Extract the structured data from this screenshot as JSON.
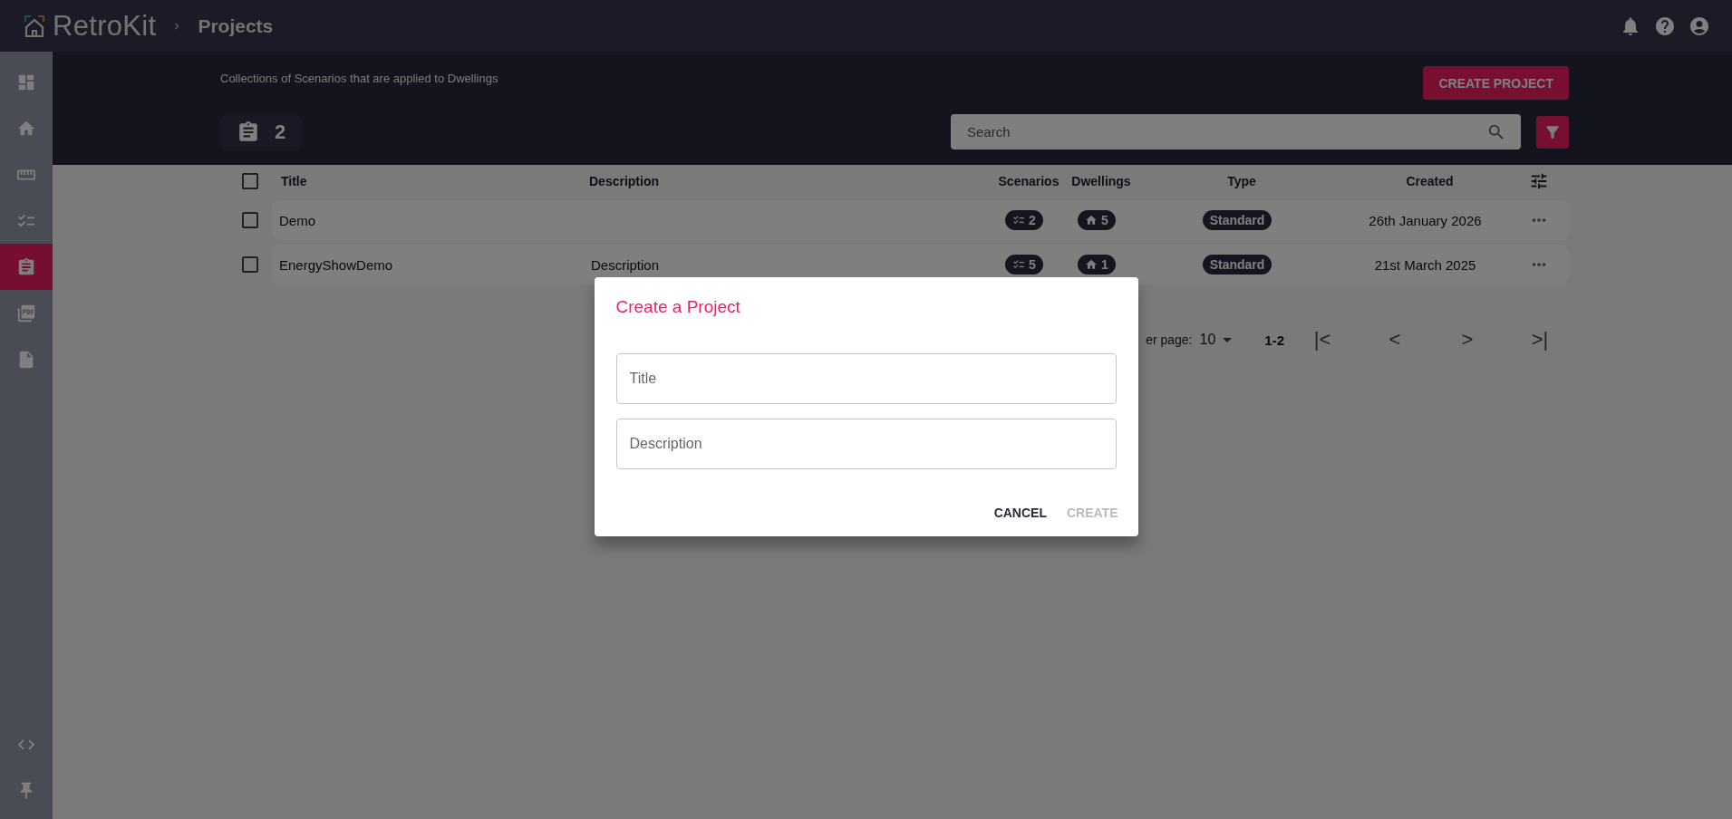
{
  "app": {
    "name": "RetroKit",
    "breadcrumb": "Projects"
  },
  "sidebar": {
    "items": [
      {
        "kind": "dashboard",
        "selected": false
      },
      {
        "kind": "home",
        "selected": false
      },
      {
        "kind": "ruler",
        "selected": false
      },
      {
        "kind": "checklist",
        "selected": false
      },
      {
        "kind": "clipboard",
        "selected": true
      },
      {
        "kind": "pdf",
        "selected": false
      },
      {
        "kind": "file",
        "selected": false
      }
    ],
    "bottom_items": [
      {
        "kind": "code",
        "selected": false
      },
      {
        "kind": "pin",
        "selected": false
      }
    ]
  },
  "header": {
    "subtitle": "Collections of Scenarios that are applied to Dwellings",
    "create_button": "CREATE PROJECT",
    "count": "2",
    "search": {
      "placeholder": "Search"
    }
  },
  "table": {
    "all_checked": false,
    "columns": [
      "Title",
      "Description",
      "Scenarios",
      "Dwellings",
      "Type",
      "Created"
    ],
    "rows": [
      {
        "checked": false,
        "title": "Demo",
        "description": "",
        "scenarios": "2",
        "dwellings": "5",
        "type": "Standard",
        "created": "26th January 2026"
      },
      {
        "checked": false,
        "title": "EnergyShowDemo",
        "description": "Description",
        "scenarios": "5",
        "dwellings": "1",
        "type": "Standard",
        "created": "21st March 2025"
      }
    ]
  },
  "pagination": {
    "rows_per_page_label": "er page:",
    "rows_per_page": "10",
    "range": "1-2",
    "buttons": [
      {
        "label": "|<"
      },
      {
        "label": "<"
      },
      {
        "label": ">"
      },
      {
        "label": ">|"
      }
    ]
  },
  "dialog": {
    "title": "Create a Project",
    "fields": [
      {
        "placeholder": "Title"
      },
      {
        "placeholder": "Description"
      }
    ],
    "actions": [
      {
        "label": "CANCEL",
        "disabled": false
      },
      {
        "label": "CREATE",
        "disabled": true
      }
    ]
  }
}
